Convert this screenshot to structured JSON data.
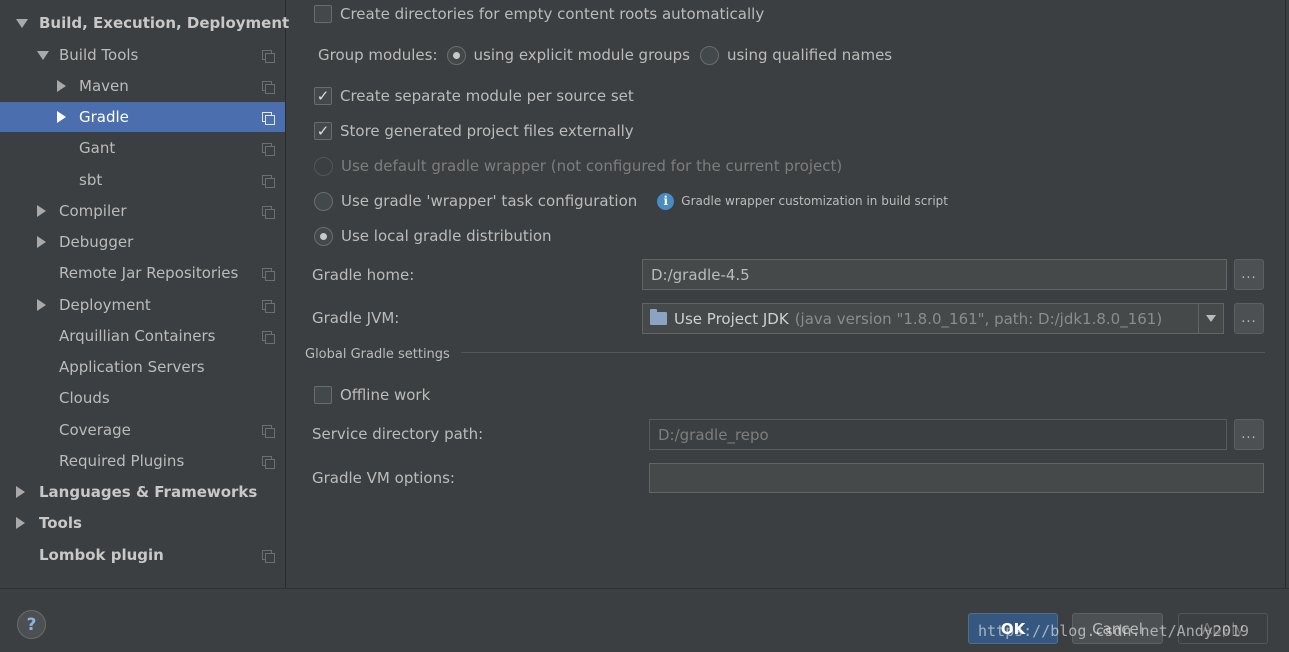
{
  "sidebar": {
    "items": [
      {
        "label": "Build, Execution, Deployment",
        "bold": true,
        "arrow": "down",
        "level": 0,
        "copy": false,
        "selected": false
      },
      {
        "label": "Build Tools",
        "bold": false,
        "arrow": "down",
        "level": 1,
        "copy": true,
        "selected": false
      },
      {
        "label": "Maven",
        "bold": false,
        "arrow": "right",
        "level": 2,
        "copy": true,
        "selected": false
      },
      {
        "label": "Gradle",
        "bold": false,
        "arrow": "right",
        "level": 2,
        "copy": true,
        "selected": true
      },
      {
        "label": "Gant",
        "bold": false,
        "arrow": "none",
        "level": 2,
        "copy": true,
        "selected": false
      },
      {
        "label": "sbt",
        "bold": false,
        "arrow": "none",
        "level": 2,
        "copy": true,
        "selected": false
      },
      {
        "label": "Compiler",
        "bold": false,
        "arrow": "right",
        "level": 1,
        "copy": true,
        "selected": false
      },
      {
        "label": "Debugger",
        "bold": false,
        "arrow": "right",
        "level": 1,
        "copy": false,
        "selected": false
      },
      {
        "label": "Remote Jar Repositories",
        "bold": false,
        "arrow": "none",
        "level": 1,
        "copy": true,
        "selected": false
      },
      {
        "label": "Deployment",
        "bold": false,
        "arrow": "right",
        "level": 1,
        "copy": true,
        "selected": false
      },
      {
        "label": "Arquillian Containers",
        "bold": false,
        "arrow": "none",
        "level": 1,
        "copy": true,
        "selected": false
      },
      {
        "label": "Application Servers",
        "bold": false,
        "arrow": "none",
        "level": 1,
        "copy": false,
        "selected": false
      },
      {
        "label": "Clouds",
        "bold": false,
        "arrow": "none",
        "level": 1,
        "copy": false,
        "selected": false
      },
      {
        "label": "Coverage",
        "bold": false,
        "arrow": "none",
        "level": 1,
        "copy": true,
        "selected": false
      },
      {
        "label": "Required Plugins",
        "bold": false,
        "arrow": "none",
        "level": 1,
        "copy": true,
        "selected": false
      },
      {
        "label": "Languages & Frameworks",
        "bold": true,
        "arrow": "right",
        "level": 0,
        "copy": false,
        "selected": false
      },
      {
        "label": "Tools",
        "bold": true,
        "arrow": "right",
        "level": 0,
        "copy": false,
        "selected": false
      },
      {
        "label": "Lombok plugin",
        "bold": true,
        "arrow": "none",
        "level": 0,
        "copy": true,
        "selected": false
      }
    ]
  },
  "settings": {
    "create_dirs": {
      "label": "Create directories for empty content roots automatically",
      "checked": false
    },
    "group_modules": {
      "label": "Group modules:",
      "option1": "using explicit module groups",
      "option2": "using qualified names",
      "selected": "option1"
    },
    "separate_module": {
      "label": "Create separate module per source set",
      "checked": true
    },
    "store_external": {
      "label": "Store generated project files externally",
      "checked": true
    },
    "wrapper_default": {
      "label": "Use default gradle wrapper (not configured for the current project)",
      "enabled": false
    },
    "wrapper_task": {
      "label": "Use gradle 'wrapper' task configuration",
      "info": "Gradle wrapper customization in build script"
    },
    "local_dist": {
      "label": "Use local gradle distribution",
      "selected": true
    },
    "gradle_home": {
      "label": "Gradle home:",
      "value": "D:/gradle-4.5",
      "browse": "..."
    },
    "gradle_jvm": {
      "label": "Gradle JVM:",
      "value": "Use Project JDK",
      "detail": "(java version \"1.8.0_161\", path: D:/jdk1.8.0_161)",
      "browse": "..."
    },
    "global_title": "Global Gradle settings",
    "offline": {
      "label": "Offline work",
      "checked": false
    },
    "service_dir": {
      "label": "Service directory path:",
      "value": "D:/gradle_repo",
      "browse": "..."
    },
    "vm_options": {
      "label": "Gradle VM options:",
      "value": ""
    }
  },
  "footer": {
    "help": "?",
    "ok": "OK",
    "cancel": "Cancel",
    "apply": "Apply",
    "watermark": "https://blog.csdn.net/Andy2019"
  },
  "colors": {
    "background": "#3c3f41",
    "selection": "#4b6eaf",
    "ok_button": "#365880",
    "info_icon": "#4a8bc2"
  }
}
